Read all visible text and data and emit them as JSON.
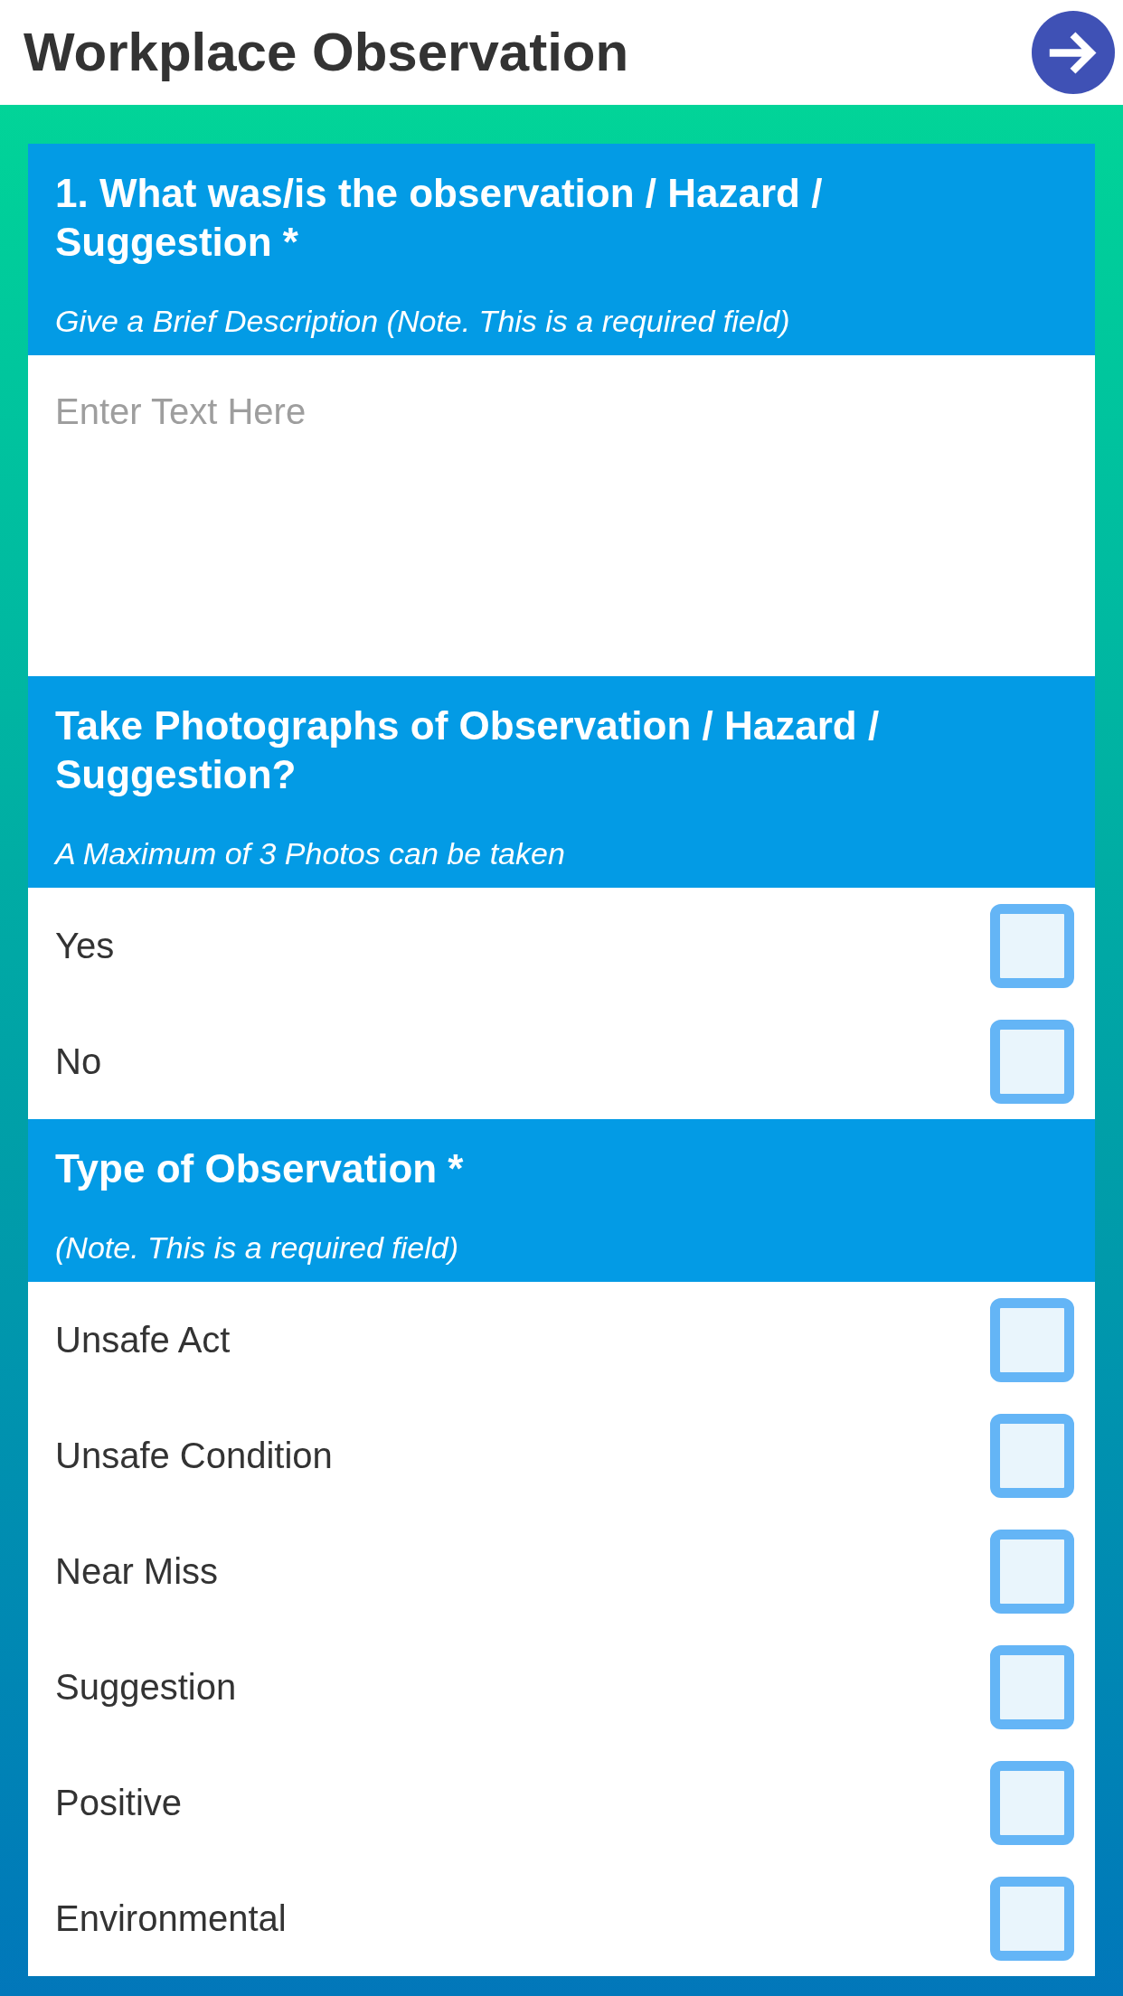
{
  "header": {
    "title": "Workplace Observation"
  },
  "sections": [
    {
      "kind": "text",
      "title": "1. What was/is the observation / Hazard / Suggestion *",
      "note": "Give a Brief Description (Note. This is a required field)",
      "field": {
        "placeholder": "Enter Text Here"
      }
    },
    {
      "kind": "checklist",
      "title": "Take Photographs of Observation / Hazard / Suggestion?",
      "note": "A Maximum of 3 Photos can be taken",
      "options": [
        {
          "label": "Yes",
          "checked": false
        },
        {
          "label": "No",
          "checked": false
        }
      ]
    },
    {
      "kind": "checklist",
      "title": "Type of Observation *",
      "note": "(Note. This is a required field)",
      "options": [
        {
          "label": "Unsafe Act",
          "checked": false
        },
        {
          "label": "Unsafe Condition",
          "checked": false
        },
        {
          "label": "Near Miss",
          "checked": false
        },
        {
          "label": "Suggestion",
          "checked": false
        },
        {
          "label": "Positive",
          "checked": false
        },
        {
          "label": "Environmental",
          "checked": false
        }
      ]
    }
  ]
}
